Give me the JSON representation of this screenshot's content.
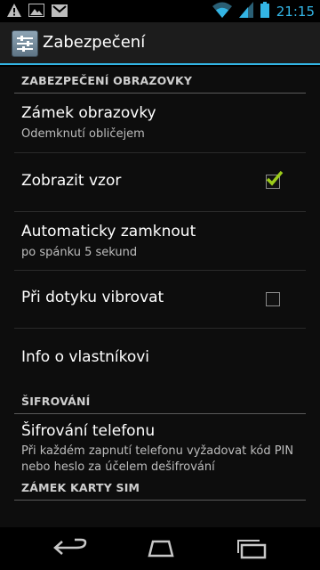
{
  "status_bar": {
    "time": "21:15",
    "left_icons": [
      "warning-icon",
      "image-icon",
      "gmail-icon"
    ],
    "right_icons": [
      "wifi-icon",
      "signal-icon",
      "battery-icon"
    ],
    "accent": "#33b5e5"
  },
  "action_bar": {
    "title": "Zabezpečení",
    "icon": "settings-icon"
  },
  "sections": {
    "screen_security": {
      "header": "ZABEZPEČENÍ OBRAZOVKY",
      "screen_lock": {
        "title": "Zámek obrazovky",
        "summary": "Odemknutí obličejem"
      },
      "show_pattern": {
        "title": "Zobrazit vzor",
        "checked": true
      },
      "auto_lock": {
        "title": "Automaticky zamknout",
        "summary": "po spánku 5 sekund"
      },
      "vibrate_touch": {
        "title": "Při dotyku vibrovat",
        "checked": false
      },
      "owner_info": {
        "title": "Info o vlastníkovi"
      }
    },
    "encryption": {
      "header": "ŠIFROVÁNÍ",
      "encrypt_phone": {
        "title": "Šifrování telefonu",
        "summary_line1": "Při každém zapnutí telefonu vyžadovat kód PIN",
        "summary_line2": "nebo heslo za účelem dešifrování"
      }
    },
    "sim_lock": {
      "header": "ZÁMEK KARTY SIM"
    }
  },
  "nav_bar": {
    "buttons": [
      "back-icon",
      "home-icon",
      "recents-icon"
    ]
  },
  "colors": {
    "checkmark": "#9ccc1a",
    "accent": "#33b5e5"
  }
}
